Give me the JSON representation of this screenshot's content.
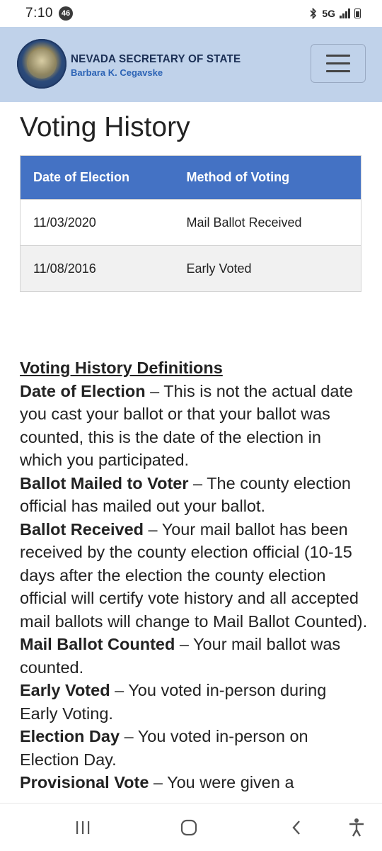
{
  "status_bar": {
    "time": "7:10",
    "notification_count": "46",
    "network": "5G"
  },
  "header": {
    "org_name": "NEVADA SECRETARY OF STATE",
    "org_sub": "Barbara K. Cegavske"
  },
  "page_title": "Voting History",
  "table": {
    "columns": [
      "Date of Election",
      "Method of Voting"
    ],
    "rows": [
      [
        "11/03/2020",
        "Mail Ballot Received"
      ],
      [
        "11/08/2016",
        "Early Voted"
      ]
    ]
  },
  "definitions": {
    "heading": "Voting History Definitions",
    "items": [
      {
        "term": "Date of Election",
        "text": " – This is not the actual date you cast your ballot or that your ballot was counted, this is the date of the election in which you participated."
      },
      {
        "term": "Ballot Mailed to Voter",
        "text": " – The county election official has mailed out your ballot."
      },
      {
        "term": "Ballot Received",
        "text": " – Your mail ballot has been received by the county election official (10-15 days after the election the county election official will certify vote history and all accepted mail ballots will change to Mail Ballot Counted)."
      },
      {
        "term": "Mail Ballot Counted",
        "text": " – Your mail ballot was counted."
      },
      {
        "term": "Early Voted",
        "text": " – You voted in-person during Early Voting."
      },
      {
        "term": "Election Day",
        "text": " – You voted in-person on Election Day."
      },
      {
        "term": "Provisional Vote",
        "text": " – You were given a"
      }
    ]
  },
  "nav_bar": {
    "icons": [
      "recent-apps-icon",
      "home-icon",
      "back-icon",
      "accessibility-icon"
    ]
  },
  "colors": {
    "header_bg": "#c0d2ea",
    "table_header_bg": "#4472c4",
    "org_name": "#1b2f55",
    "org_sub": "#2c63b5"
  }
}
